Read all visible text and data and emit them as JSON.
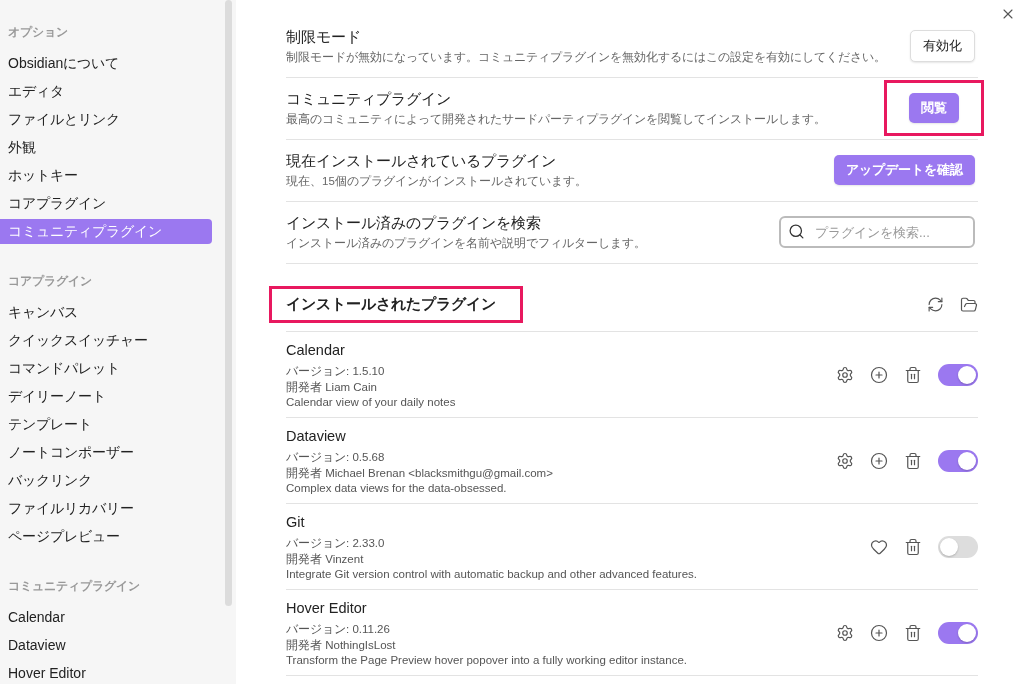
{
  "sidebar": {
    "groups": [
      {
        "title": "オプション",
        "items": [
          {
            "label": "Obsidianについて",
            "selected": false
          },
          {
            "label": "エディタ",
            "selected": false
          },
          {
            "label": "ファイルとリンク",
            "selected": false
          },
          {
            "label": "外観",
            "selected": false
          },
          {
            "label": "ホットキー",
            "selected": false
          },
          {
            "label": "コアプラグイン",
            "selected": false
          },
          {
            "label": "コミュニティプラグイン",
            "selected": true
          }
        ]
      },
      {
        "title": "コアプラグイン",
        "items": [
          {
            "label": "キャンバス",
            "selected": false
          },
          {
            "label": "クイックスイッチャー",
            "selected": false
          },
          {
            "label": "コマンドパレット",
            "selected": false
          },
          {
            "label": "デイリーノート",
            "selected": false
          },
          {
            "label": "テンプレート",
            "selected": false
          },
          {
            "label": "ノートコンポーザー",
            "selected": false
          },
          {
            "label": "バックリンク",
            "selected": false
          },
          {
            "label": "ファイルリカバリー",
            "selected": false
          },
          {
            "label": "ページプレビュー",
            "selected": false
          }
        ]
      },
      {
        "title": "コミュニティプラグイン",
        "items": [
          {
            "label": "Calendar",
            "selected": false
          },
          {
            "label": "Dataview",
            "selected": false
          },
          {
            "label": "Hover Editor",
            "selected": false
          }
        ]
      }
    ]
  },
  "settings": [
    {
      "name": "制限モード",
      "description": "制限モードが無効になっています。コミュニティプラグインを無効化するにはこの設定を有効にしてください。",
      "kind": "button",
      "control": "有効化",
      "accent": false,
      "highlighted": false
    },
    {
      "name": "コミュニティプラグイン",
      "description": "最高のコミュニティによって開発されたサードパーティプラグインを閲覧してインストールします。",
      "kind": "button",
      "control": "閲覧",
      "accent": true,
      "highlighted": true
    },
    {
      "name": "現在インストールされているプラグイン",
      "description": "現在、15個のプラグインがインストールされています。",
      "kind": "button",
      "control": "アップデートを確認",
      "accent": true,
      "highlighted": false
    },
    {
      "name": "インストール済みのプラグインを検索",
      "description": "インストール済みのプラグインを名前や説明でフィルターします。",
      "kind": "search",
      "placeholder": "プラグインを検索...",
      "highlighted": false
    }
  ],
  "installed_heading": {
    "title": "インストールされたプラグイン",
    "highlighted": true
  },
  "plugins": [
    {
      "name": "Calendar",
      "version": "バージョン: 1.5.10",
      "author": "開発者 Liam Cain",
      "description": "Calendar view of your daily notes",
      "actions": [
        {
          "kind": "settings"
        },
        {
          "kind": "hotkey"
        },
        {
          "kind": "delete"
        }
      ],
      "on": true
    },
    {
      "name": "Dataview",
      "version": "バージョン: 0.5.68",
      "author": "開発者 Michael Brenan <blacksmithgu@gmail.com>",
      "description": "Complex data views for the data-obsessed.",
      "actions": [
        {
          "kind": "settings"
        },
        {
          "kind": "hotkey"
        },
        {
          "kind": "delete"
        }
      ],
      "on": true
    },
    {
      "name": "Git",
      "version": "バージョン: 2.33.0",
      "author": "開発者 Vinzent",
      "description": "Integrate Git version control with automatic backup and other advanced features.",
      "actions": [
        {
          "kind": "donate"
        },
        {
          "kind": "delete"
        }
      ],
      "on": false
    },
    {
      "name": "Hover Editor",
      "version": "バージョン: 0.11.26",
      "author": "開発者 NothingIsLost",
      "description": "Transform the Page Preview hover popover into a fully working editor instance.",
      "actions": [
        {
          "kind": "settings"
        },
        {
          "kind": "hotkey"
        },
        {
          "kind": "delete"
        }
      ],
      "on": true
    }
  ]
}
